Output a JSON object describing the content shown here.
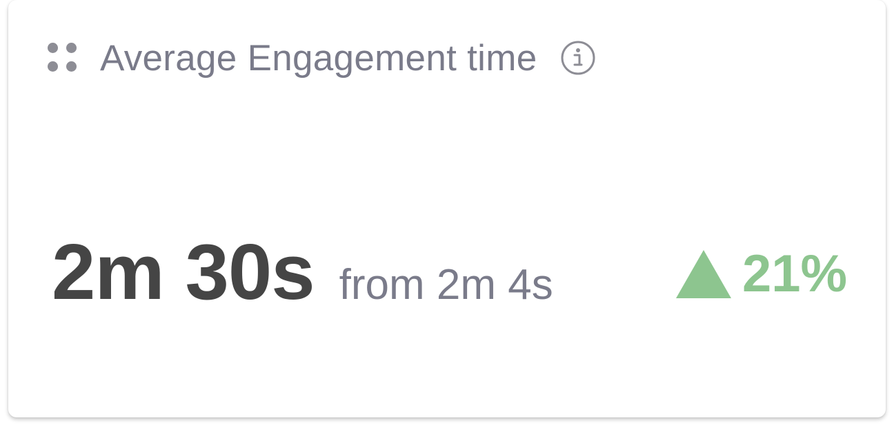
{
  "card": {
    "title": "Average Engagement time",
    "icons": {
      "drag": "drag-handle-icon",
      "info": "info-icon"
    }
  },
  "metric": {
    "value": "2m 30s",
    "comparison": "from 2m 4s",
    "delta": {
      "direction": "up",
      "label": "21%",
      "color": "#8dc58f"
    }
  },
  "colors": {
    "title_text": "#7a7b8a",
    "value_text": "#454545",
    "icon": "#8d8d95",
    "positive": "#8dc58f"
  }
}
